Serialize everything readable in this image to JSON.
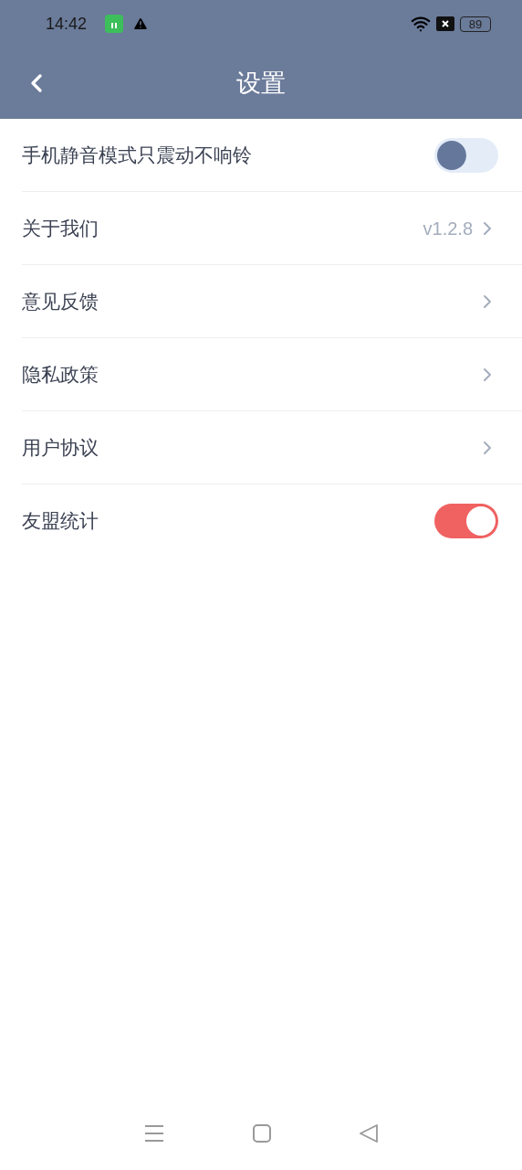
{
  "status_bar": {
    "time": "14:42",
    "battery": "89"
  },
  "header": {
    "title": "设置"
  },
  "rows": [
    {
      "kind": "toggle",
      "label": "手机静音模式只震动不响铃",
      "on": false
    },
    {
      "kind": "link",
      "label": "关于我们",
      "value": "v1.2.8"
    },
    {
      "kind": "link",
      "label": "意见反馈"
    },
    {
      "kind": "link",
      "label": "隐私政策"
    },
    {
      "kind": "link",
      "label": "用户协议"
    },
    {
      "kind": "toggle",
      "label": "友盟统计",
      "on": true
    }
  ]
}
